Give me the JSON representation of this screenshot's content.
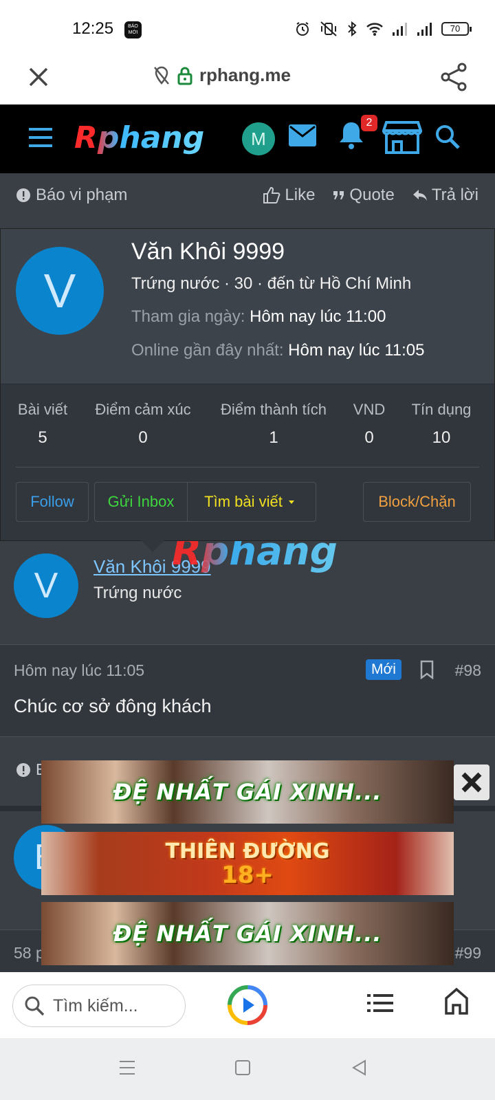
{
  "status_bar": {
    "time": "12:25",
    "app_badge": "BÁO MỚI",
    "battery": "70"
  },
  "browser": {
    "url": "rphang.me"
  },
  "site": {
    "logo": "Rphang",
    "user_initial": "M",
    "notification_count": "2",
    "watermark": "Rphang"
  },
  "post_actions": {
    "report": "Báo vi phạm",
    "like": "Like",
    "quote": "Quote",
    "reply": "Trả lời"
  },
  "member_card": {
    "avatar_initial": "V",
    "name": "Văn Khôi 9999",
    "summary": "Trứng nước · 30 · đến từ Hồ Chí Minh",
    "joined_label": "Tham gia ngày:",
    "joined_value": "Hôm nay lúc 11:00",
    "last_seen_label": "Online gần đây nhất:",
    "last_seen_value": "Hôm nay lúc 11:05",
    "stats": [
      {
        "label": "Bài viết",
        "value": "5"
      },
      {
        "label": "Điểm cảm xúc",
        "value": "0"
      },
      {
        "label": "Điểm thành tích",
        "value": "1"
      },
      {
        "label": "VND",
        "value": "0"
      },
      {
        "label": "Tín dụng",
        "value": "10"
      }
    ],
    "buttons": {
      "follow": "Follow",
      "inbox": "Gửi Inbox",
      "find_posts": "Tìm bài viết",
      "block": "Block/Chặn"
    },
    "colors": {
      "follow": "#3a9ee8",
      "inbox": "#3ed63e",
      "find_posts": "#f0e020",
      "block": "#f0a040"
    }
  },
  "post": {
    "author_initial": "V",
    "author_name": "Văn Khôi 9999",
    "author_role": "Trứng nước",
    "date": "Hôm nay lúc 11:05",
    "new_badge": "Mới",
    "number": "#98",
    "message": "Chúc cơ sở đông khách"
  },
  "next_post": {
    "report_partial": "B",
    "avatar_initial": "B",
    "meta_partial": "58 p",
    "number": "#99"
  },
  "ads": [
    {
      "text": "ĐỆ NHẤT GÁI XINH..."
    },
    {
      "text_line1": "THIÊN ĐƯỜNG",
      "text_line2": "18+"
    },
    {
      "text": "ĐỆ NHẤT GÁI XINH..."
    }
  ],
  "bottom_bar": {
    "search_placeholder": "Tìm kiếm..."
  }
}
